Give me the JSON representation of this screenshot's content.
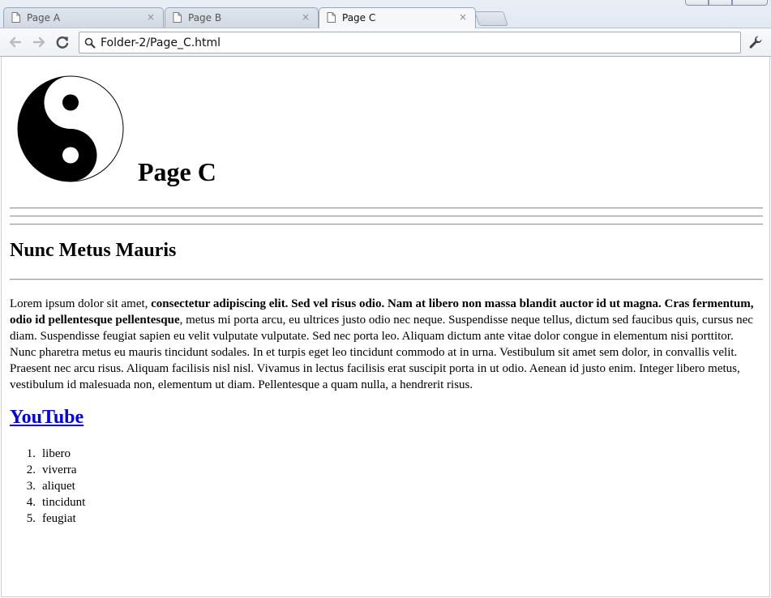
{
  "browser": {
    "tabs": [
      {
        "label": "Page A",
        "close": "×",
        "active": false
      },
      {
        "label": "Page B",
        "close": "×",
        "active": false
      },
      {
        "label": "Page C",
        "close": "×",
        "active": true
      }
    ],
    "address": "Folder-2/Page_C.html",
    "icons": {
      "back": "back-arrow-icon",
      "forward": "forward-arrow-icon",
      "reload": "reload-icon",
      "search": "search-icon",
      "menu": "wrench-icon",
      "page": "page-icon"
    }
  },
  "page": {
    "title": "Page C",
    "section_title": "Nunc Metus Mauris",
    "paragraph": {
      "intro": "Lorem ipsum dolor sit amet, ",
      "bold": "consectetur adipiscing elit. Sed vel risus odio. Nam at libero non massa blandit auctor id ut magna. Cras fermentum, odio id pellentesque pellentesque",
      "rest": ", metus mi porta arcu, eu ultrices justo odio nec neque. Suspendisse neque tellus, dictum sed faucibus quis, cursus nec diam. Suspendisse feugiat sapien eu velit vulputate vulputate. Sed nec porta leo. Aliquam dictum ante vitae dolor congue in elementum nisi porttitor. Nunc pharetra metus eu mauris tincidunt sodales. In et turpis eget leo tincidunt commodo at in urna. Vestibulum sit amet sem dolor, in convallis velit. Praesent nec arcu risus. Aliquam facilisis nisl nisl. Vivamus in lectus facilisis erat suscipit porta in ut odio. Aenean id justo enim. Integer libero metus, vestibulum id malesuada non, elementum ut diam. Pellentesque a quam nulla, a hendrerit risus."
    },
    "link": "YouTube",
    "list": [
      {
        "num": "1.",
        "text": "libero"
      },
      {
        "num": "2.",
        "text": "viverra"
      },
      {
        "num": "3.",
        "text": "aliquet"
      },
      {
        "num": "4.",
        "text": "tincidunt"
      },
      {
        "num": "5.",
        "text": "feugiat"
      }
    ],
    "colors": {
      "link": "#0000ee",
      "text": "#000000"
    }
  }
}
